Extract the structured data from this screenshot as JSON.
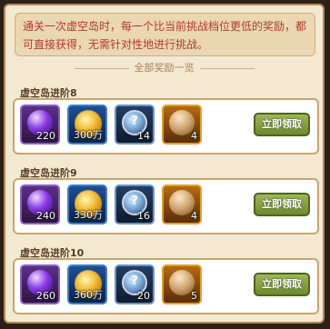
{
  "intro": "通关一次虚空岛时，每一个比当前挑战档位更低的奖励，都可直接获得，无需针对性地进行挑战。",
  "section_title": "全部奖励一览",
  "groups": [
    {
      "title": "虚空岛进阶8",
      "items": [
        {
          "icon": "purple-orb-icon",
          "count": "220"
        },
        {
          "icon": "gold-coin-icon",
          "count": "300万"
        },
        {
          "icon": "mystery-gem-icon",
          "count": "14"
        },
        {
          "icon": "item-bag-icon",
          "count": "4"
        }
      ],
      "button": "立即领取"
    },
    {
      "title": "虚空岛进阶9",
      "items": [
        {
          "icon": "purple-orb-icon",
          "count": "240"
        },
        {
          "icon": "gold-coin-icon",
          "count": "330万"
        },
        {
          "icon": "mystery-gem-icon",
          "count": "16"
        },
        {
          "icon": "item-bag-icon",
          "count": "4"
        }
      ],
      "button": "立即领取"
    },
    {
      "title": "虚空岛进阶10",
      "items": [
        {
          "icon": "purple-orb-icon",
          "count": "260"
        },
        {
          "icon": "gold-coin-icon",
          "count": "360万"
        },
        {
          "icon": "mystery-gem-icon",
          "count": "20"
        },
        {
          "icon": "item-bag-icon",
          "count": "5"
        }
      ],
      "button": "立即领取"
    }
  ]
}
